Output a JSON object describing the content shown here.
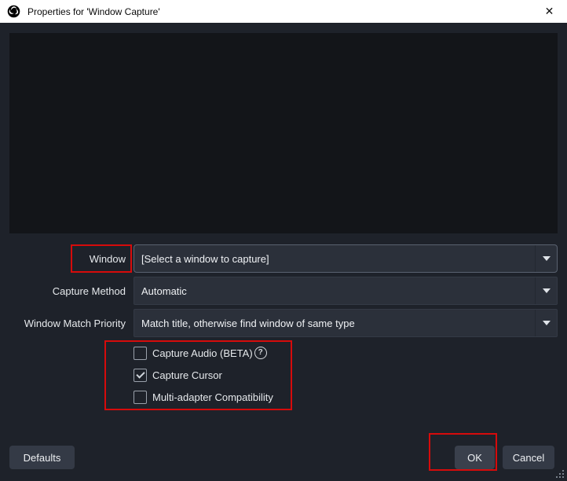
{
  "window": {
    "title": "Properties for 'Window Capture'",
    "close_glyph": "✕"
  },
  "form": {
    "rows": [
      {
        "label": "Window",
        "value": "[Select a window to capture]"
      },
      {
        "label": "Capture Method",
        "value": "Automatic"
      },
      {
        "label": "Window Match Priority",
        "value": "Match title, otherwise find window of same type"
      }
    ],
    "checkboxes": [
      {
        "label": "Capture Audio (BETA)",
        "checked": false,
        "has_help": true
      },
      {
        "label": "Capture Cursor",
        "checked": true,
        "has_help": false
      },
      {
        "label": "Multi-adapter Compatibility",
        "checked": false,
        "has_help": false
      }
    ],
    "help_glyph": "?"
  },
  "buttons": {
    "defaults": "Defaults",
    "ok": "OK",
    "cancel": "Cancel"
  },
  "annotations": [
    {
      "target": "window-label",
      "color": "#d60b0b"
    },
    {
      "target": "capture-options-group",
      "color": "#d60b0b"
    },
    {
      "target": "ok-button",
      "color": "#d60b0b"
    }
  ],
  "colors": {
    "annotation_red": "#d60b0b",
    "titlebar_bg": "#ffffff",
    "titlebar_text": "#0a0a0a",
    "dialog_bg": "#1e222a",
    "preview_bg": "#131519",
    "control_bg": "#2b303a",
    "button_bg": "#343a46",
    "text": "#e6e9ec"
  }
}
